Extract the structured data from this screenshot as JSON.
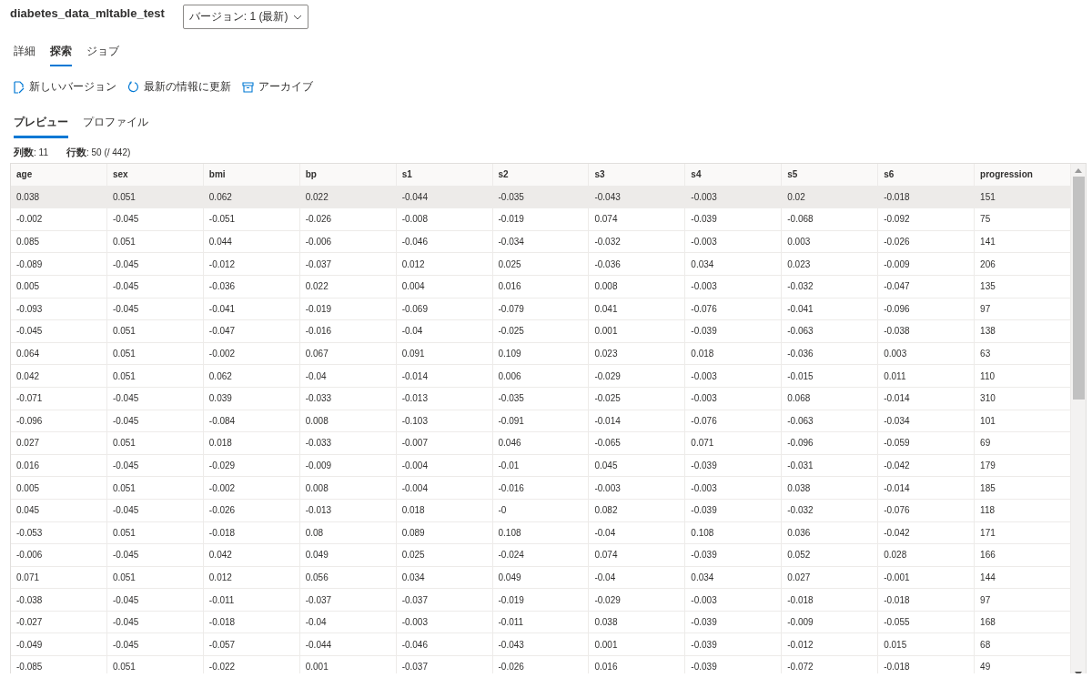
{
  "header": {
    "title": "diabetes_data_mltable_test",
    "version_dropdown": "バージョン: 1 (最新)"
  },
  "tabs": [
    {
      "label": "詳細",
      "selected": false
    },
    {
      "label": "探索",
      "selected": true
    },
    {
      "label": "ジョブ",
      "selected": false
    }
  ],
  "toolbar": [
    {
      "label": "新しいバージョン",
      "kind": "new"
    },
    {
      "label": "最新の情報に更新",
      "kind": "refresh"
    },
    {
      "label": "アーカイブ",
      "kind": "archive"
    }
  ],
  "subtabs": [
    {
      "label": "プレビュー",
      "selected": true
    },
    {
      "label": "プロファイル",
      "selected": false
    }
  ],
  "stats": [
    "**列数**: 11",
    "**行数**: 50 (/ 442)"
  ],
  "table": {
    "columns": [
      "age",
      "sex",
      "bmi",
      "bp",
      "s1",
      "s2",
      "s3",
      "s4",
      "s5",
      "s6",
      "progression"
    ],
    "rows": [
      {
        "selected": true,
        "cells": [
          "0.038",
          "0.051",
          "0.062",
          "0.022",
          "-0.044",
          "-0.035",
          "-0.043",
          "-0.003",
          "0.02",
          "-0.018",
          "151"
        ]
      },
      {
        "selected": false,
        "cells": [
          "-0.002",
          "-0.045",
          "-0.051",
          "-0.026",
          "-0.008",
          "-0.019",
          "0.074",
          "-0.039",
          "-0.068",
          "-0.092",
          "75"
        ]
      },
      {
        "selected": false,
        "cells": [
          "0.085",
          "0.051",
          "0.044",
          "-0.006",
          "-0.046",
          "-0.034",
          "-0.032",
          "-0.003",
          "0.003",
          "-0.026",
          "141"
        ]
      },
      {
        "selected": false,
        "cells": [
          "-0.089",
          "-0.045",
          "-0.012",
          "-0.037",
          "0.012",
          "0.025",
          "-0.036",
          "0.034",
          "0.023",
          "-0.009",
          "206"
        ]
      },
      {
        "selected": false,
        "cells": [
          "0.005",
          "-0.045",
          "-0.036",
          "0.022",
          "0.004",
          "0.016",
          "0.008",
          "-0.003",
          "-0.032",
          "-0.047",
          "135"
        ]
      },
      {
        "selected": false,
        "cells": [
          "-0.093",
          "-0.045",
          "-0.041",
          "-0.019",
          "-0.069",
          "-0.079",
          "0.041",
          "-0.076",
          "-0.041",
          "-0.096",
          "97"
        ]
      },
      {
        "selected": false,
        "cells": [
          "-0.045",
          "0.051",
          "-0.047",
          "-0.016",
          "-0.04",
          "-0.025",
          "0.001",
          "-0.039",
          "-0.063",
          "-0.038",
          "138"
        ]
      },
      {
        "selected": false,
        "cells": [
          "0.064",
          "0.051",
          "-0.002",
          "0.067",
          "0.091",
          "0.109",
          "0.023",
          "0.018",
          "-0.036",
          "0.003",
          "63"
        ]
      },
      {
        "selected": false,
        "cells": [
          "0.042",
          "0.051",
          "0.062",
          "-0.04",
          "-0.014",
          "0.006",
          "-0.029",
          "-0.003",
          "-0.015",
          "0.011",
          "110"
        ]
      },
      {
        "selected": false,
        "cells": [
          "-0.071",
          "-0.045",
          "0.039",
          "-0.033",
          "-0.013",
          "-0.035",
          "-0.025",
          "-0.003",
          "0.068",
          "-0.014",
          "310"
        ]
      },
      {
        "selected": false,
        "cells": [
          "-0.096",
          "-0.045",
          "-0.084",
          "0.008",
          "-0.103",
          "-0.091",
          "-0.014",
          "-0.076",
          "-0.063",
          "-0.034",
          "101"
        ]
      },
      {
        "selected": false,
        "cells": [
          "0.027",
          "0.051",
          "0.018",
          "-0.033",
          "-0.007",
          "0.046",
          "-0.065",
          "0.071",
          "-0.096",
          "-0.059",
          "69"
        ]
      },
      {
        "selected": false,
        "cells": [
          "0.016",
          "-0.045",
          "-0.029",
          "-0.009",
          "-0.004",
          "-0.01",
          "0.045",
          "-0.039",
          "-0.031",
          "-0.042",
          "179"
        ]
      },
      {
        "selected": false,
        "cells": [
          "0.005",
          "0.051",
          "-0.002",
          "0.008",
          "-0.004",
          "-0.016",
          "-0.003",
          "-0.003",
          "0.038",
          "-0.014",
          "185"
        ]
      },
      {
        "selected": false,
        "cells": [
          "0.045",
          "-0.045",
          "-0.026",
          "-0.013",
          "0.018",
          "-0",
          "0.082",
          "-0.039",
          "-0.032",
          "-0.076",
          "118"
        ]
      },
      {
        "selected": false,
        "cells": [
          "-0.053",
          "0.051",
          "-0.018",
          "0.08",
          "0.089",
          "0.108",
          "-0.04",
          "0.108",
          "0.036",
          "-0.042",
          "171"
        ]
      },
      {
        "selected": false,
        "cells": [
          "-0.006",
          "-0.045",
          "0.042",
          "0.049",
          "0.025",
          "-0.024",
          "0.074",
          "-0.039",
          "0.052",
          "0.028",
          "166"
        ]
      },
      {
        "selected": false,
        "cells": [
          "0.071",
          "0.051",
          "0.012",
          "0.056",
          "0.034",
          "0.049",
          "-0.04",
          "0.034",
          "0.027",
          "-0.001",
          "144"
        ]
      },
      {
        "selected": false,
        "cells": [
          "-0.038",
          "-0.045",
          "-0.011",
          "-0.037",
          "-0.037",
          "-0.019",
          "-0.029",
          "-0.003",
          "-0.018",
          "-0.018",
          "97"
        ]
      },
      {
        "selected": false,
        "cells": [
          "-0.027",
          "-0.045",
          "-0.018",
          "-0.04",
          "-0.003",
          "-0.011",
          "0.038",
          "-0.039",
          "-0.009",
          "-0.055",
          "168"
        ]
      },
      {
        "selected": false,
        "cells": [
          "-0.049",
          "-0.045",
          "-0.057",
          "-0.044",
          "-0.046",
          "-0.043",
          "0.001",
          "-0.039",
          "-0.012",
          "0.015",
          "68"
        ]
      },
      {
        "selected": false,
        "cells": [
          "-0.085",
          "0.051",
          "-0.022",
          "0.001",
          "-0.037",
          "-0.026",
          "0.016",
          "-0.039",
          "-0.072",
          "-0.018",
          "49"
        ]
      }
    ]
  }
}
